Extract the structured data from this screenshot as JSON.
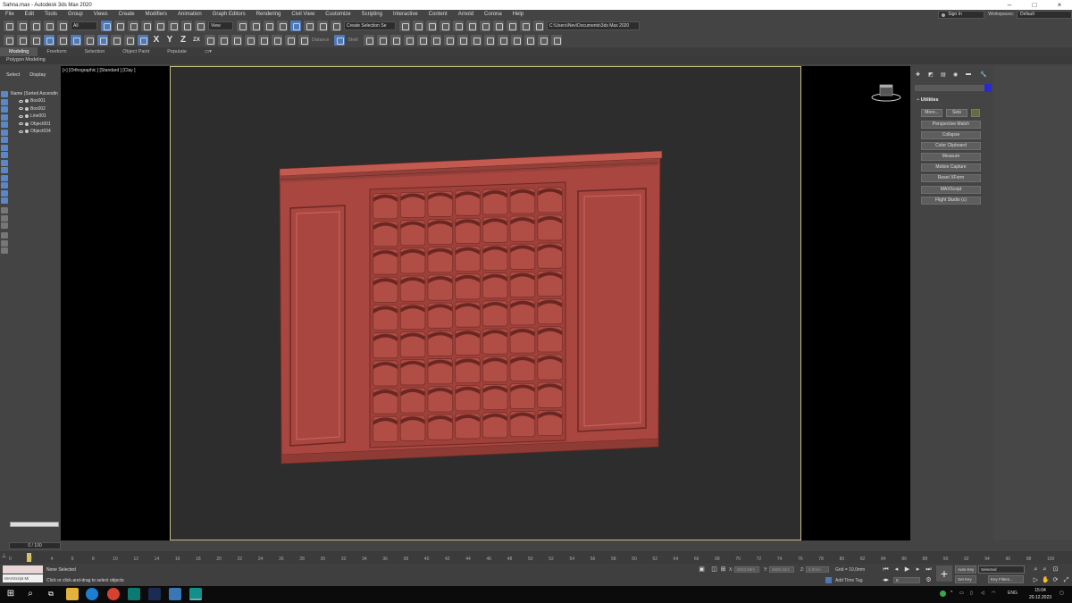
{
  "window": {
    "title": "Sahna.max - Autodesk 3ds Max 2020"
  },
  "menu": [
    "File",
    "Edit",
    "Tools",
    "Group",
    "Views",
    "Create",
    "Modifiers",
    "Animation",
    "Graph Editors",
    "Rendering",
    "Civil View",
    "Customize",
    "Scripting",
    "Interactive",
    "Content",
    "Arnold",
    "Corona",
    "Help"
  ],
  "account": {
    "signin": "Sign In",
    "workspaces_label": "Workspaces:",
    "workspace": "Default"
  },
  "toolbar": {
    "selection_filter": "All",
    "ref_coord": "View",
    "named_selection": "Create Selection Se",
    "project_path": "C:\\Users\\Nev\\Documents\\3ds Max 2020",
    "axes": [
      "X",
      "Y",
      "Z",
      "ZX"
    ],
    "disabled_1": "Distance",
    "disabled_2": "Shell"
  },
  "ribbon": {
    "tabs": [
      "Modeling",
      "Freeform",
      "Selection",
      "Object Paint",
      "Populate"
    ],
    "active": "Modeling",
    "sub": "Polygon Modeling"
  },
  "scene_explorer": {
    "tabs": [
      "Select",
      "Display"
    ],
    "column": "Name (Sorted Ascendin",
    "objects": [
      "Box001",
      "Box002",
      "Line001",
      "Object001",
      "Object034"
    ]
  },
  "viewport": {
    "label": "[+] [Orthographic ] [Standard ] [Clay ]",
    "wall_color": "#a8463f"
  },
  "command_panel": {
    "rollout": "Utilities",
    "more": "More...",
    "sets": "Sets",
    "utilities": [
      "Perspective Match",
      "Collapse",
      "Color Clipboard",
      "Measure",
      "Motion Capture",
      "Reset XForm",
      "MAXScript",
      "Flight Studio (c)"
    ]
  },
  "timeline": {
    "frame": "0 / 100",
    "ticks": [
      "0",
      "2",
      "4",
      "6",
      "8",
      "10",
      "12",
      "14",
      "16",
      "18",
      "20",
      "22",
      "24",
      "26",
      "28",
      "30",
      "32",
      "34",
      "36",
      "38",
      "40",
      "42",
      "44",
      "46",
      "48",
      "50",
      "52",
      "54",
      "56",
      "58",
      "60",
      "62",
      "64",
      "66",
      "68",
      "70",
      "72",
      "74",
      "76",
      "78",
      "80",
      "82",
      "84",
      "86",
      "88",
      "90",
      "92",
      "94",
      "96",
      "98",
      "100"
    ]
  },
  "status": {
    "maxscript": "MAXScript Mi",
    "line1": "None Selected",
    "line2": "Click or click-and-drag to select objects",
    "x_label": "X:",
    "x": "6033.58m",
    "y_label": "Y:",
    "y": "5800.22m",
    "z_label": "Z:",
    "z": "0.0mm",
    "grid": "Grid = 10,0mm",
    "add_time_tag": "Add Time Tag",
    "auto_key": "Auto Key",
    "selected": "Selected",
    "set_key": "Set Key",
    "key_filters": "Key Filters...",
    "frame_field": "0"
  },
  "taskbar": {
    "lang": "ENG",
    "time": "15:04",
    "date": "20.12.2023"
  }
}
